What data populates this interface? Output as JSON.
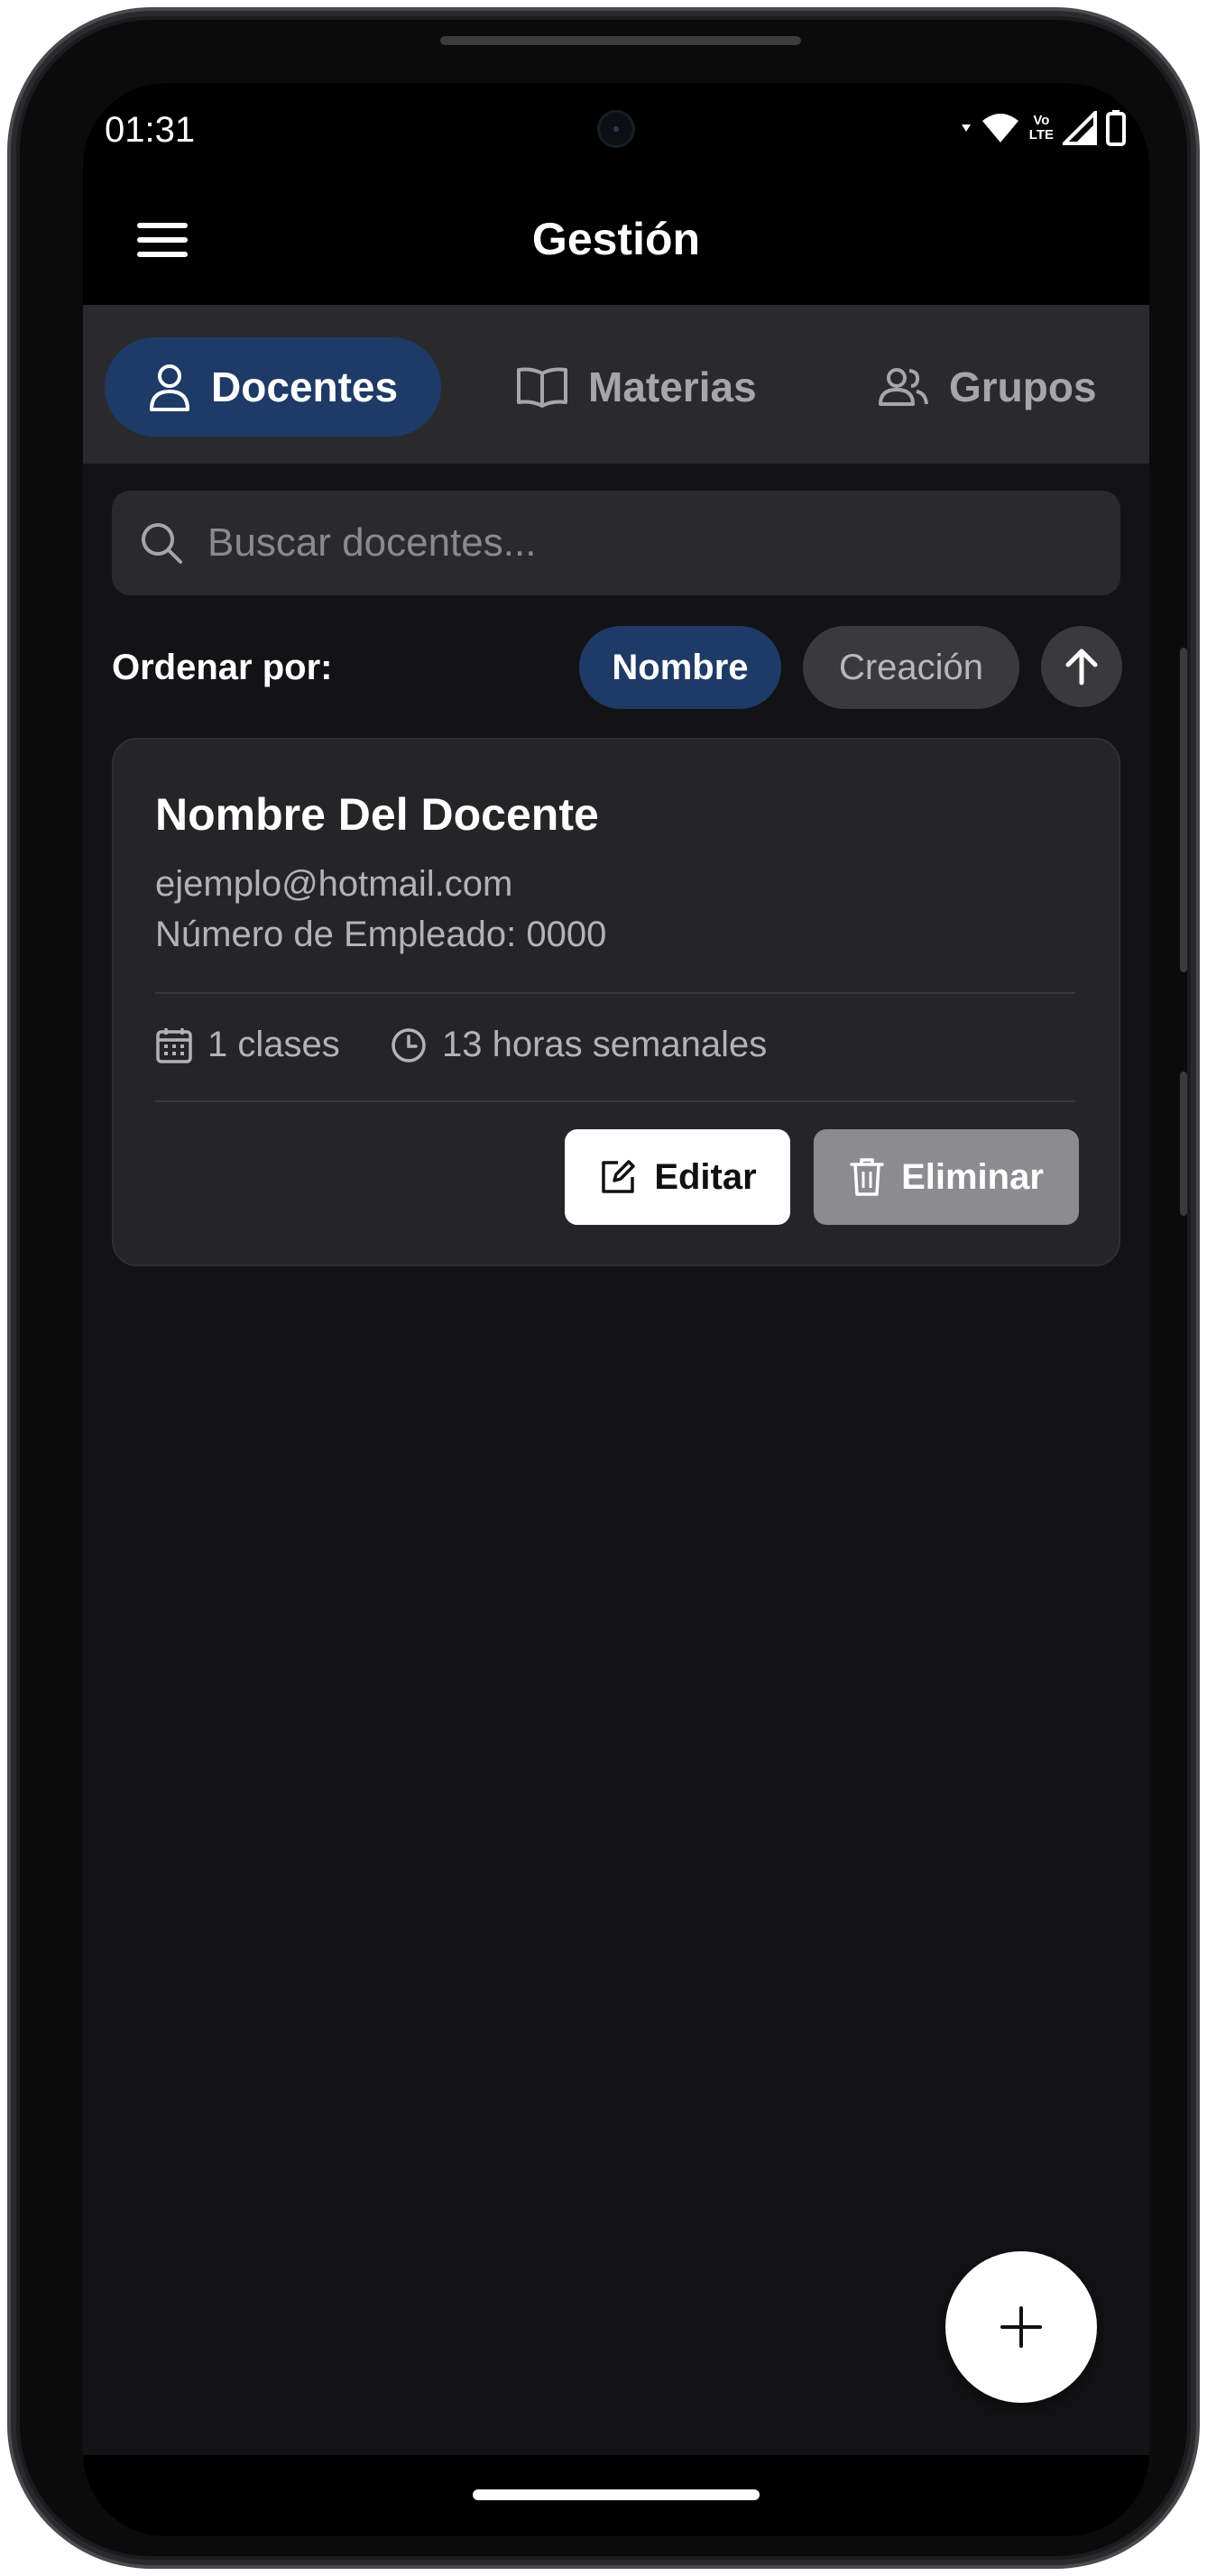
{
  "status_bar": {
    "time": "01:31",
    "volte_top": "Vo",
    "volte_bottom": "LTE"
  },
  "app_bar": {
    "title": "Gestión"
  },
  "tabs": [
    {
      "label": "Docentes",
      "icon": "person-icon",
      "active": true
    },
    {
      "label": "Materias",
      "icon": "book-icon",
      "active": false
    },
    {
      "label": "Grupos",
      "icon": "group-icon",
      "active": false
    }
  ],
  "search": {
    "placeholder": "Buscar docentes...",
    "value": ""
  },
  "sort": {
    "label": "Ordenar por:",
    "options": [
      {
        "label": "Nombre",
        "selected": true
      },
      {
        "label": "Creación",
        "selected": false
      }
    ],
    "direction_icon": "arrow-up-icon"
  },
  "teacher_card": {
    "name": "Nombre Del Docente",
    "email": "ejemplo@hotmail.com",
    "employee_number": "Número de Empleado: 0000",
    "classes": "1 clases",
    "hours": "13 horas semanales",
    "edit_label": "Editar",
    "delete_label": "Eliminar"
  },
  "fab": {
    "icon": "plus-icon"
  },
  "colors": {
    "background": "#131315",
    "surface": "#2a2a2c",
    "card": "#252527",
    "accent": "#1e3a66",
    "delete_button": "#8c8c90"
  }
}
